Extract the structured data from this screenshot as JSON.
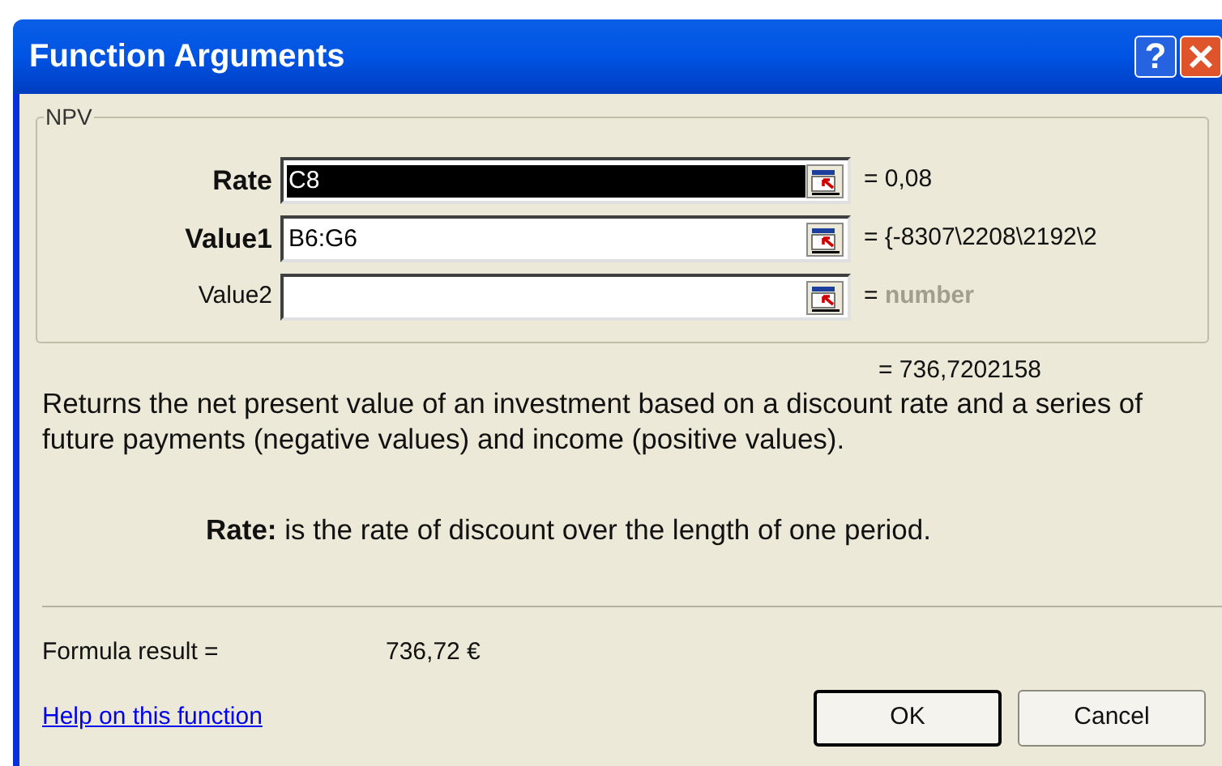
{
  "window": {
    "title": "Function Arguments"
  },
  "title_buttons": [
    {
      "kind": "help",
      "label": "?"
    },
    {
      "kind": "close"
    }
  ],
  "group": {
    "title": "NPV",
    "arguments": [
      {
        "label": "Rate",
        "required": true,
        "value": "C8",
        "selected": true,
        "result": "= 0,08"
      },
      {
        "label": "Value1",
        "required": true,
        "value": "B6:G6",
        "selected": false,
        "result": "= {-8307\\2208\\2192\\2"
      },
      {
        "label": "Value2",
        "required": false,
        "selected": false,
        "result": "= ",
        "hint": "number"
      }
    ]
  },
  "result": "= 736,7202158",
  "description": "Returns the net present value of an investment based on a discount rate and a series of future payments (negative values) and income (positive values).",
  "argument_help": "**Rate:** is the rate of discount over the length of one period.",
  "formula_result": {
    "label": "Formula result =",
    "value": "736,72 €"
  },
  "help_link": "Help on this function",
  "buttons": [
    {
      "label": "OK",
      "default": true
    },
    {
      "label": "Cancel",
      "default": false
    }
  ]
}
